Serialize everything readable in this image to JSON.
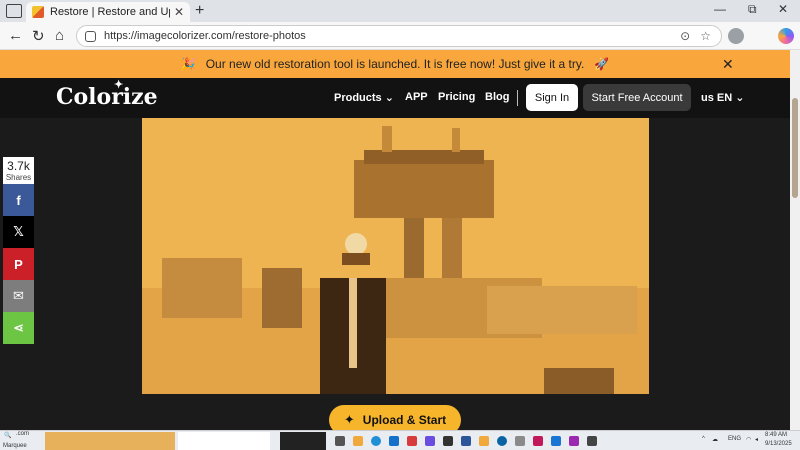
{
  "browser": {
    "tab_title": "Restore | Restore and Upscale Ol",
    "tab_close": "✕",
    "new_tab": "+",
    "minimize": "—",
    "maximize": "⧉",
    "close": "✕",
    "url": "https://imagecolorizer.com/restore-photos"
  },
  "banner": {
    "text": "Our new old restoration tool is launched. It is free now! Just give it a try.",
    "left_deco": "🎉",
    "right_deco": "🚀",
    "close": "✕"
  },
  "header": {
    "logo": "Colorize",
    "logo_star": "✦",
    "nav": {
      "products": "Products",
      "app": "APP",
      "pricing": "Pricing",
      "blog": "Blog"
    },
    "chevron": "⌄",
    "sign_in": "Sign In",
    "start_free": "Start Free Account",
    "lang": "us EN"
  },
  "share": {
    "count": "3.7k",
    "label": "Shares",
    "buttons": [
      {
        "name": "facebook",
        "glyph": "f",
        "color": "#3b5998"
      },
      {
        "name": "x",
        "glyph": "𝕏",
        "color": "#000000"
      },
      {
        "name": "pinterest",
        "glyph": "P",
        "color": "#cb2027"
      },
      {
        "name": "email",
        "glyph": "✉",
        "color": "#7d7d7d"
      },
      {
        "name": "share",
        "glyph": "⋖",
        "color": "#6cc644"
      }
    ]
  },
  "upload": {
    "icon": "✦",
    "label": "Upload & Start"
  },
  "taskbar": {
    "app_label": ".com",
    "app_caption": "Marquee",
    "lang": "ENG",
    "time": "8:49 AM",
    "date": "9/13/2025"
  },
  "colors": {
    "banner": "#f9a73c",
    "upload": "#f7b52b",
    "header_bg": "#121212"
  }
}
